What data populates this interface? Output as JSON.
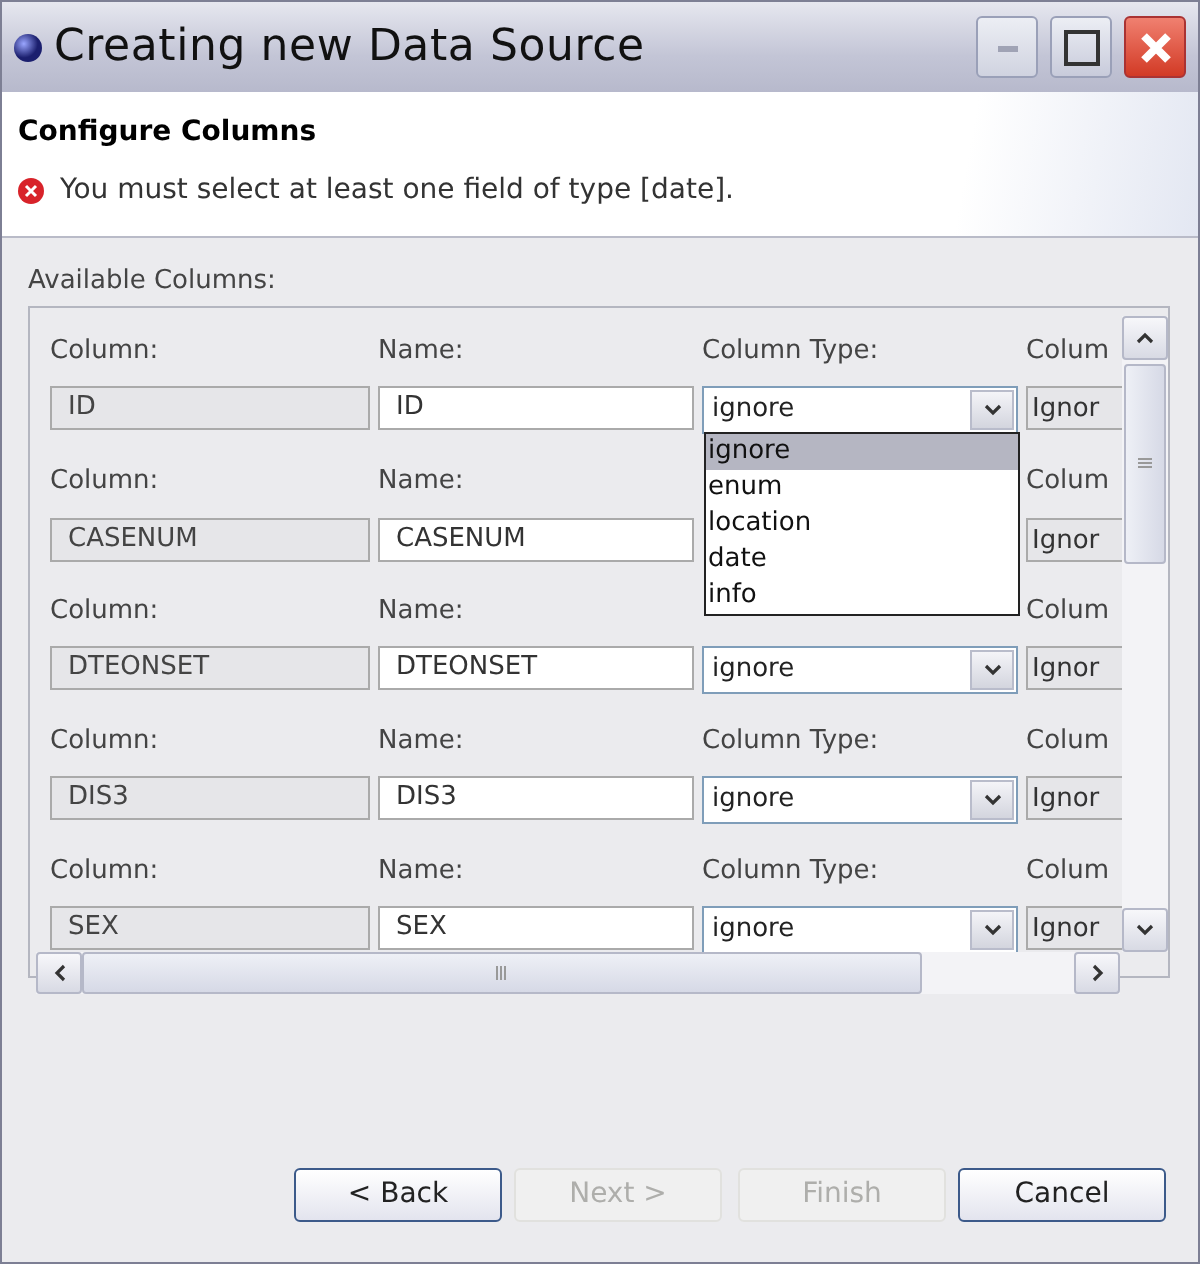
{
  "window": {
    "title": "Creating new Data Source"
  },
  "header": {
    "title": "Configure Columns",
    "message": "You must select at least one field of type [date]."
  },
  "section_label": "Available Columns:",
  "rows": [
    {
      "column_label": "Column:",
      "column": "ID",
      "name_label": "Name:",
      "name": "ID",
      "type_label": "Column Type:",
      "type": "ignore",
      "extra_label": "Colum",
      "extra": "Ignor"
    },
    {
      "column_label": "Column:",
      "column": "CASENUM",
      "name_label": "Name:",
      "name": "CASENUM",
      "extra_label": "Colum",
      "extra": "Ignor"
    },
    {
      "column_label": "Column:",
      "column": "DTEONSET",
      "name_label": "Name:",
      "name": "DTEONSET",
      "type": "ignore",
      "extra_label": "Colum",
      "extra": "Ignor"
    },
    {
      "column_label": "Column:",
      "column": "DIS3",
      "name_label": "Name:",
      "name": "DIS3",
      "type_label": "Column Type:",
      "type": "ignore",
      "extra_label": "Colum",
      "extra": "Ignor"
    },
    {
      "column_label": "Column:",
      "column": "SEX",
      "name_label": "Name:",
      "name": "SEX",
      "type_label": "Column Type:",
      "type": "ignore",
      "extra_label": "Colum",
      "extra": "Ignor"
    }
  ],
  "dropdown": {
    "options": [
      {
        "label": "ignore",
        "selected": true
      },
      {
        "label": "enum",
        "selected": false
      },
      {
        "label": "location",
        "selected": false
      },
      {
        "label": "date",
        "selected": false
      },
      {
        "label": "info",
        "selected": false
      }
    ]
  },
  "buttons": [
    {
      "label": "< Back",
      "disabled": false
    },
    {
      "label": "Next >",
      "disabled": true
    },
    {
      "label": "Finish",
      "disabled": true
    },
    {
      "label": "Cancel",
      "disabled": false
    }
  ]
}
